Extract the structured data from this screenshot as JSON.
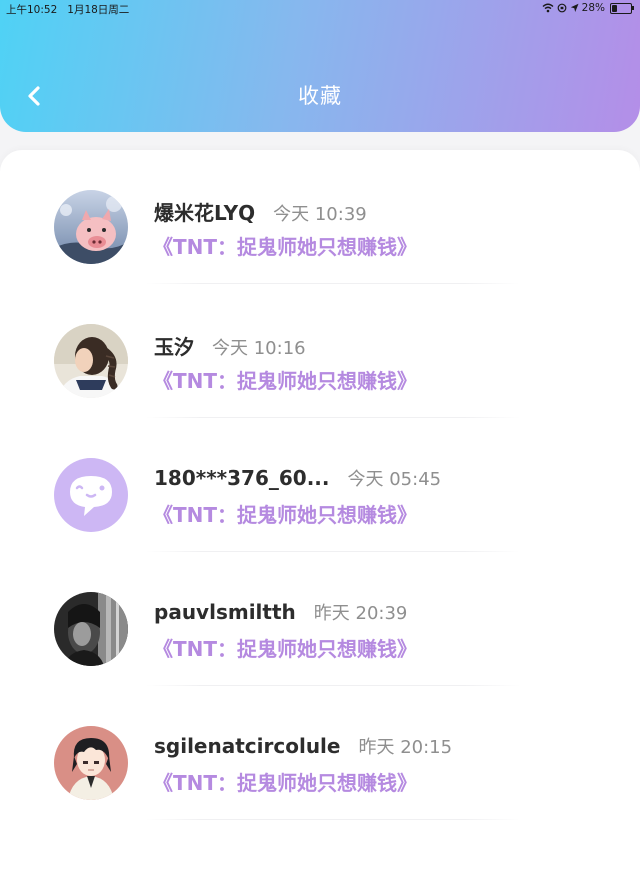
{
  "status_bar": {
    "time": "上午10:52",
    "date": "1月18日周二",
    "battery": "28%",
    "battery_level": 0.28
  },
  "header": {
    "title": "收藏"
  },
  "colors": {
    "accent": "#b58ae0",
    "header_gradient_start": "#4fd2f5",
    "header_gradient_end": "#b48ee8"
  },
  "favorites": [
    {
      "name": "爆米花LYQ",
      "time": "今天 10:39",
      "work": "《TNT：捉鬼师她只想赚钱》",
      "avatar": "pig-avatar"
    },
    {
      "name": "玉汐",
      "time": "今天 10:16",
      "work": "《TNT：捉鬼师她只想赚钱》",
      "avatar": "girl-braid-avatar"
    },
    {
      "name": "180***376_60...",
      "time": "今天 05:45",
      "work": "《TNT：捉鬼师她只想赚钱》",
      "avatar": "default-chat-avatar"
    },
    {
      "name": "pauvlsmiltth",
      "time": "昨天 20:39",
      "work": "《TNT：捉鬼师她只想赚钱》",
      "avatar": "bw-portrait-avatar"
    },
    {
      "name": "sgilenatcircolule",
      "time": "昨天 20:15",
      "work": "《TNT：捉鬼师她只想赚钱》",
      "avatar": "anime-boy-avatar"
    }
  ]
}
